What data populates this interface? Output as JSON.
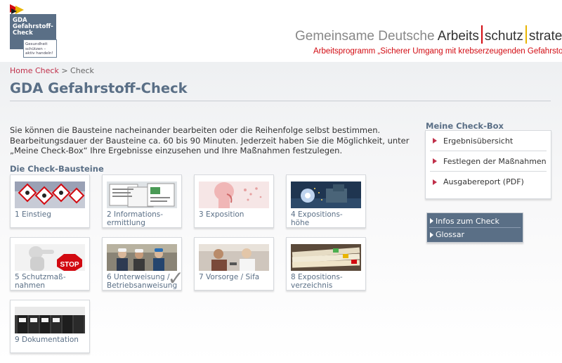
{
  "header": {
    "logo": {
      "line1": "GDA",
      "line2": "Gefahrstoff-",
      "line3": "Check",
      "sub1": "Gesundheit",
      "sub2": "schützen –",
      "sub3": "aktiv handeln!"
    },
    "gda": {
      "part1": "Gemeinsame Deutsche ",
      "part2": "Arbeits",
      "part3": "schutz",
      "part4": "strategie"
    },
    "subtitle": "Arbeitsprogramm „Sicherer Umgang mit krebserzeugenden Gefahrstoffen“"
  },
  "breadcrumb": {
    "home": "Home Check",
    "separator": " > ",
    "current": "Check"
  },
  "page_title": "GDA Gefahrstoff-Check",
  "intro": "Sie können die Bausteine nacheinander bearbeiten oder die Reihenfolge selbst bestimmen. Bearbeitungsdauer der Bausteine ca. 60 bis 90 Minuten. Jederzeit haben Sie die Möglichkeit, unter „Meine Check-Box“ Ihre Ergebnisse einzusehen und Ihre Maßnahmen festzulegen.",
  "section_heading": "Die Check-Bausteine",
  "tiles": [
    {
      "label": "1 Einstieg",
      "thumb": "hazard-symbols"
    },
    {
      "label": "2 Informations-\nermittlung",
      "thumb": "documents"
    },
    {
      "label": "3 Exposition",
      "thumb": "respiratory"
    },
    {
      "label": "4 Expositions-\nhöhe",
      "thumb": "welding"
    },
    {
      "label": "5 Schutzmaß-\nnahmen",
      "thumb": "stop-sign"
    },
    {
      "label": "6 Unterweisung /\nBetriebsanweisung",
      "thumb": "workers",
      "completed": true
    },
    {
      "label": "7 Vorsorge / Sifa",
      "thumb": "consultation"
    },
    {
      "label": "8 Expositions-\nverzeichnis",
      "thumb": "folders"
    },
    {
      "label": "9 Dokumentation",
      "thumb": "binders"
    }
  ],
  "sidebar": {
    "heading": "Meine Check-Box",
    "items": [
      "Ergebnisübersicht",
      "Festlegen der Maßnahmen",
      "Ausgabereport (PDF)"
    ],
    "infos": [
      "Infos zum Check",
      "Glossar"
    ]
  },
  "colors": {
    "accent": "#5a6f86",
    "brand_red": "#d20a11",
    "link_red": "#c0304a",
    "gold": "#e8b400"
  }
}
